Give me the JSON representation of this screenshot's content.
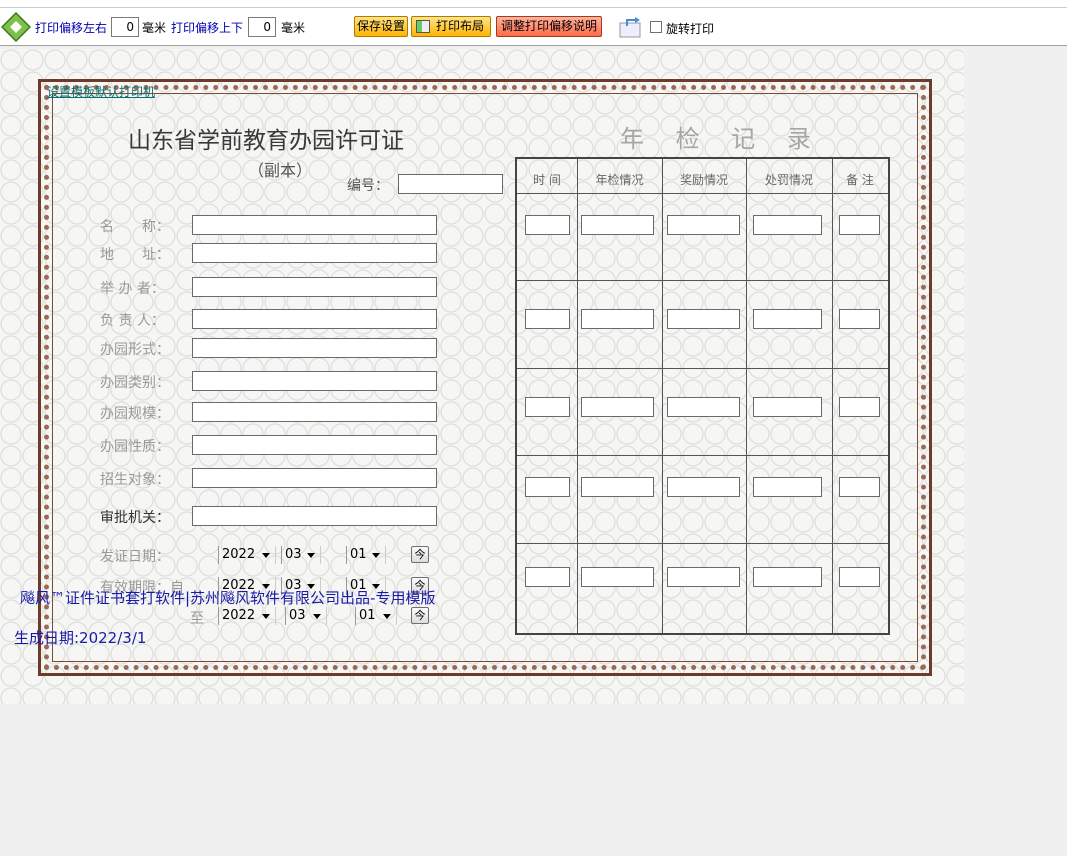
{
  "toolbar": {
    "offset_x_label": "打印偏移左右",
    "offset_x_value": "0",
    "offset_x_unit": "毫米",
    "offset_y_label": "打印偏移上下",
    "offset_y_value": "0",
    "offset_y_unit": "毫米",
    "save_label": "保存设置",
    "layout_label": "打印布局",
    "help_label": "调整打印偏移说明",
    "rotate_label": "旋转打印",
    "rotate_checked": false
  },
  "page": {
    "default_printer_link": "设置模板默认打印机",
    "title": "山东省学前教育办园许可证",
    "subtitle": "（副本）",
    "number_label": "编号：",
    "number_value": "",
    "fields": [
      {
        "label": "名　　称：",
        "value": ""
      },
      {
        "label": "地　　址：",
        "value": ""
      },
      {
        "label": "举 办 者：",
        "value": ""
      },
      {
        "label": "负 责 人：",
        "value": ""
      },
      {
        "label": "办园形式：",
        "value": ""
      },
      {
        "label": "办园类别：",
        "value": ""
      },
      {
        "label": "办园规模：",
        "value": ""
      },
      {
        "label": "办园性质：",
        "value": ""
      },
      {
        "label": "招生对象：",
        "value": ""
      },
      {
        "label": "审批机关：",
        "value": ""
      }
    ],
    "issue_date_label": "发证日期：",
    "valid_label": "有效期限：自",
    "valid_to_label": "至",
    "issue_date": {
      "year": "2022",
      "month": "03",
      "day": "01"
    },
    "valid_from": {
      "year": "2022",
      "month": "03",
      "day": "01"
    },
    "valid_to": {
      "year": "2022",
      "month": "03",
      "day": "01"
    },
    "spin_label": "今",
    "record_title": "年 检 记 录",
    "record_columns": [
      "时 间",
      "年检情况",
      "奖励情况",
      "处罚情况",
      "备 注"
    ],
    "record_rows": 5,
    "footer_brand": "飚风™证件证书套打软件|苏州飚风软件有限公司出品-专用模版",
    "footer_date": "生成日期:2022/3/1"
  },
  "colors": {
    "link": "#0000b0",
    "footer_text": "#1a1aa8",
    "border_brown": "#6e3a2a",
    "save_button": "#ffb400",
    "help_button": "#ff6b4a"
  }
}
